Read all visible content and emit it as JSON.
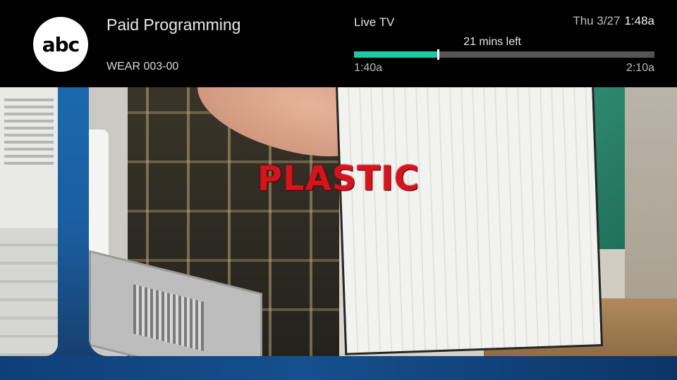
{
  "overlay": {
    "network_logo": "abc",
    "program_title": "Paid Programming",
    "channel": "WEAR 003-00",
    "mode_label": "Live TV",
    "date": "Thu 3/27",
    "current_time": "1:48a",
    "time_left": "21 mins left",
    "start_time": "1:40a",
    "end_time": "2:10a",
    "progress_fraction": 0.28,
    "progress_color": "#1fc7a3"
  },
  "video": {
    "caption": "PLASTIC",
    "caption_color": "#d6141d"
  }
}
